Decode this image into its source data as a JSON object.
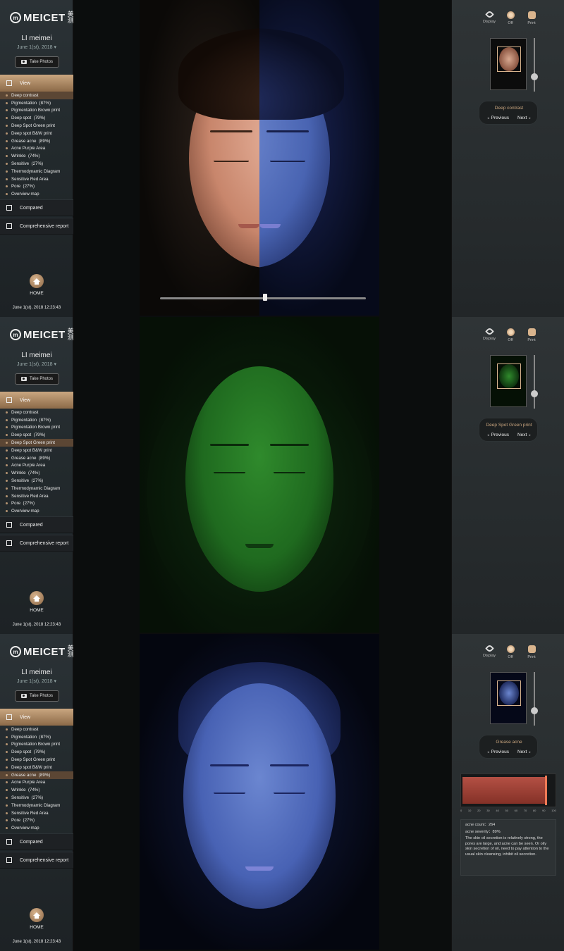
{
  "app": {
    "logo_text": "MEICET",
    "logo_cn": "美测",
    "user_name": "LI meimei",
    "user_date": "June 1(st), 2018",
    "take_photos": "Take Photos",
    "view_tab": "View",
    "compared_tab": "Compared",
    "report_tab": "Comprehensive report",
    "home": "HOME",
    "timestamp": "June 1(st), 2018 12:23:43"
  },
  "menu": [
    "Deep contrast",
    "Pigmentation  (87%)",
    "Pigmentation Brown print",
    "Deep spot  (79%)",
    "Deep Spot Green print",
    "Deep spot B&W print",
    "Grease acne  (89%)",
    "Acne Purple Area",
    "Wrinkle  (74%)",
    "Sensitive  (27%)",
    "Thermodynamic Diagram",
    "Sensitive Red Area",
    "Pore  (27%)",
    "Overview map"
  ],
  "tools": {
    "display": "Display",
    "off": "Off",
    "print": "Print"
  },
  "nav": {
    "previous": "Previous",
    "next": "Next"
  },
  "screens": [
    {
      "active_index": 0,
      "mode": "Deep contrast"
    },
    {
      "active_index": 4,
      "mode": "Deep Spot Green print"
    },
    {
      "active_index": 6,
      "mode": "Grease acne"
    }
  ],
  "acne": {
    "scale": [
      "0",
      "10",
      "20",
      "30",
      "40",
      "50",
      "60",
      "70",
      "80",
      "90",
      "100"
    ],
    "count_line": "acne count：264",
    "severity_line": "acne severity：89%",
    "description": "The skin oil secretion is relatively strong, the pores are large, and acne can be seen. Or oily skin secretion of oil, need to pay attention to the usual skin cleansing, inhibit oil secretion.",
    "severity": 89
  },
  "colors": {
    "accent": "#c9a680",
    "active_row": "#5b4634",
    "green": "#1c7a1f",
    "uv_blue": "#3e5fb8"
  }
}
